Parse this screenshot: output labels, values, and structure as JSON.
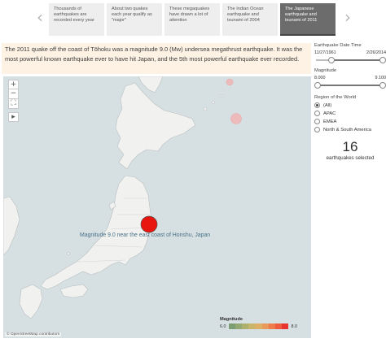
{
  "story": {
    "prev_icon": "chevron-left-icon",
    "next_icon": "chevron-right-icon",
    "points": [
      {
        "label": "Thousands of earthquakes are recorded every year",
        "active": false
      },
      {
        "label": "About two quakes each year qualify as \"major\"",
        "active": false
      },
      {
        "label": "These megaquakes have drawn a lot of attention",
        "active": false
      },
      {
        "label": "The Indian Ocean earthquake and tsunami of 2004",
        "active": false
      },
      {
        "label": "The Japanese earthquake and tsunami of 2011",
        "active": true
      }
    ]
  },
  "caption": {
    "text": "The 2011 quake off the coast of Tōhoku was a magnitude 9.0 (Mw) undersea megathrust earthquake. It was the most powerful known earthquake ever to have hit Japan, and the 5th most powerful earthquake ever recorded."
  },
  "map": {
    "tools": [
      "+",
      "−",
      "⛶",
      "▸"
    ],
    "annotation": "Magnitude 9.0 near the east coast of Honshu, Japan",
    "attribution": "© OpenStreetMap contributors",
    "quake_color": "#e8140e",
    "minor_color": "#f0b8b8"
  },
  "legend": {
    "title": "Magnitude",
    "min": "6.0",
    "max": "8.0",
    "colors": [
      "#7d9d72",
      "#93a873",
      "#aeb06e",
      "#c8b46a",
      "#ddb065",
      "#e99a5a",
      "#ee7a4c",
      "#ef5a3e",
      "#e8342e"
    ]
  },
  "filters": {
    "date": {
      "label": "Earthquake Date Time",
      "min": "11/27/1961",
      "max": "2/26/2014"
    },
    "magnitude": {
      "label": "Magnitude",
      "min": "8.000",
      "max": "9.100",
      "low_fraction": 0.0,
      "high_fraction": 1.0
    },
    "region": {
      "label": "Region of the World",
      "options": [
        {
          "label": "(All)",
          "checked": true
        },
        {
          "label": "APAC",
          "checked": false
        },
        {
          "label": "EMEA",
          "checked": false
        },
        {
          "label": "North & South America",
          "checked": false
        }
      ]
    }
  },
  "summary": {
    "count": "16",
    "label": "earthquakes selected"
  }
}
